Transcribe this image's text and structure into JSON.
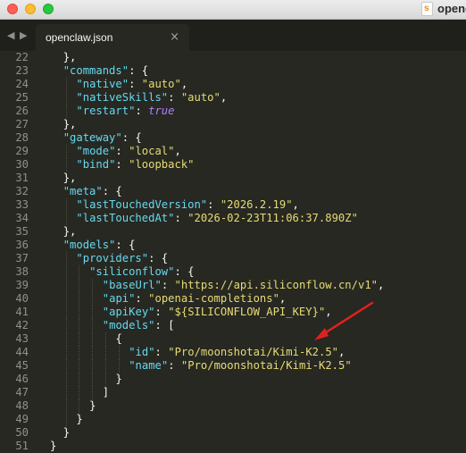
{
  "window": {
    "title": "openc",
    "app_icon_letter": "s"
  },
  "tabbar": {
    "back_glyph": "◀",
    "forward_glyph": "▶",
    "tabs": [
      {
        "label": "openclaw.json",
        "close_glyph": "×"
      }
    ]
  },
  "editor": {
    "lines": [
      {
        "n": "22",
        "indent": 1,
        "t": [
          [
            "p",
            "},"
          ]
        ]
      },
      {
        "n": "23",
        "indent": 1,
        "t": [
          [
            "k",
            "\"commands\""
          ],
          [
            "p",
            ": {"
          ]
        ]
      },
      {
        "n": "24",
        "indent": 2,
        "t": [
          [
            "k",
            "\"native\""
          ],
          [
            "p",
            ": "
          ],
          [
            "s",
            "\"auto\""
          ],
          [
            "p",
            ","
          ]
        ]
      },
      {
        "n": "25",
        "indent": 2,
        "t": [
          [
            "k",
            "\"nativeSkills\""
          ],
          [
            "p",
            ": "
          ],
          [
            "s",
            "\"auto\""
          ],
          [
            "p",
            ","
          ]
        ]
      },
      {
        "n": "26",
        "indent": 2,
        "t": [
          [
            "k",
            "\"restart\""
          ],
          [
            "p",
            ": "
          ],
          [
            "kw",
            "true"
          ]
        ]
      },
      {
        "n": "27",
        "indent": 1,
        "t": [
          [
            "p",
            "},"
          ]
        ]
      },
      {
        "n": "28",
        "indent": 1,
        "t": [
          [
            "k",
            "\"gateway\""
          ],
          [
            "p",
            ": {"
          ]
        ]
      },
      {
        "n": "29",
        "indent": 2,
        "t": [
          [
            "k",
            "\"mode\""
          ],
          [
            "p",
            ": "
          ],
          [
            "s",
            "\"local\""
          ],
          [
            "p",
            ","
          ]
        ]
      },
      {
        "n": "30",
        "indent": 2,
        "t": [
          [
            "k",
            "\"bind\""
          ],
          [
            "p",
            ": "
          ],
          [
            "s",
            "\"loopback\""
          ]
        ]
      },
      {
        "n": "31",
        "indent": 1,
        "t": [
          [
            "p",
            "},"
          ]
        ]
      },
      {
        "n": "32",
        "indent": 1,
        "t": [
          [
            "k",
            "\"meta\""
          ],
          [
            "p",
            ": {"
          ]
        ]
      },
      {
        "n": "33",
        "indent": 2,
        "t": [
          [
            "k",
            "\"lastTouchedVersion\""
          ],
          [
            "p",
            ": "
          ],
          [
            "s",
            "\"2026.2.19\""
          ],
          [
            "p",
            ","
          ]
        ]
      },
      {
        "n": "34",
        "indent": 2,
        "t": [
          [
            "k",
            "\"lastTouchedAt\""
          ],
          [
            "p",
            ": "
          ],
          [
            "s",
            "\"2026-02-23T11:06:37.890Z\""
          ]
        ]
      },
      {
        "n": "35",
        "indent": 1,
        "t": [
          [
            "p",
            "},"
          ]
        ]
      },
      {
        "n": "36",
        "indent": 1,
        "t": [
          [
            "k",
            "\"models\""
          ],
          [
            "p",
            ": {"
          ]
        ]
      },
      {
        "n": "37",
        "indent": 2,
        "t": [
          [
            "k",
            "\"providers\""
          ],
          [
            "p",
            ": {"
          ]
        ]
      },
      {
        "n": "38",
        "indent": 3,
        "t": [
          [
            "k",
            "\"siliconflow\""
          ],
          [
            "p",
            ": {"
          ]
        ]
      },
      {
        "n": "39",
        "indent": 4,
        "t": [
          [
            "k",
            "\"baseUrl\""
          ],
          [
            "p",
            ": "
          ],
          [
            "s",
            "\"https://api.siliconflow.cn/v1\""
          ],
          [
            "p",
            ","
          ]
        ]
      },
      {
        "n": "40",
        "indent": 4,
        "t": [
          [
            "k",
            "\"api\""
          ],
          [
            "p",
            ": "
          ],
          [
            "s",
            "\"openai-completions\""
          ],
          [
            "p",
            ","
          ]
        ]
      },
      {
        "n": "41",
        "indent": 4,
        "t": [
          [
            "k",
            "\"apiKey\""
          ],
          [
            "p",
            ": "
          ],
          [
            "s",
            "\"${SILICONFLOW_API_KEY}\""
          ],
          [
            "p",
            ","
          ]
        ]
      },
      {
        "n": "42",
        "indent": 4,
        "t": [
          [
            "k",
            "\"models\""
          ],
          [
            "p",
            ": ["
          ]
        ]
      },
      {
        "n": "43",
        "indent": 5,
        "t": [
          [
            "p",
            "{"
          ]
        ]
      },
      {
        "n": "44",
        "indent": 6,
        "t": [
          [
            "k",
            "\"id\""
          ],
          [
            "p",
            ": "
          ],
          [
            "s",
            "\"Pro/moonshotai/Kimi-K2.5\""
          ],
          [
            "p",
            ","
          ]
        ]
      },
      {
        "n": "45",
        "indent": 6,
        "t": [
          [
            "k",
            "\"name\""
          ],
          [
            "p",
            ": "
          ],
          [
            "s",
            "\"Pro/moonshotai/Kimi-K2.5\""
          ]
        ]
      },
      {
        "n": "46",
        "indent": 5,
        "t": [
          [
            "p",
            "}"
          ]
        ]
      },
      {
        "n": "47",
        "indent": 4,
        "t": [
          [
            "p",
            "]"
          ]
        ]
      },
      {
        "n": "48",
        "indent": 3,
        "t": [
          [
            "p",
            "}"
          ]
        ]
      },
      {
        "n": "49",
        "indent": 2,
        "t": [
          [
            "p",
            "}"
          ]
        ]
      },
      {
        "n": "50",
        "indent": 1,
        "t": [
          [
            "p",
            "}"
          ]
        ]
      },
      {
        "n": "51",
        "indent": 0,
        "t": [
          [
            "p",
            "}"
          ]
        ]
      }
    ]
  },
  "colors": {
    "editor_bg": "#272822",
    "key": "#66d9ef",
    "string": "#e6db74",
    "punctuation": "#f8f8f2",
    "constant": "#ae81ff",
    "line_number": "#90908a",
    "annotation_arrow": "#e0211d"
  }
}
